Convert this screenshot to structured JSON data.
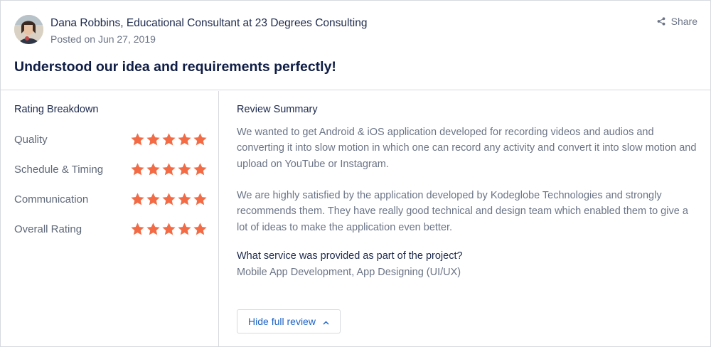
{
  "review": {
    "author": "Dana Robbins, Educational Consultant at 23 Degrees Consulting",
    "posted": "Posted on Jun 27, 2019",
    "share_label": "Share",
    "title": "Understood our idea and requirements perfectly!"
  },
  "ratings": {
    "heading": "Rating Breakdown",
    "items": [
      {
        "label": "Quality",
        "stars": 5
      },
      {
        "label": "Schedule & Timing",
        "stars": 5
      },
      {
        "label": "Communication",
        "stars": 5
      },
      {
        "label": "Overall Rating",
        "stars": 5
      }
    ],
    "star_color": "#f26b45"
  },
  "summary": {
    "heading": "Review Summary",
    "paragraphs": [
      "We wanted to get Android & iOS application developed for recording videos and audios and converting it into slow motion in which one can record any activity and convert it into slow motion and upload on YouTube or Instagram.",
      "We are highly satisfied by the application developed by Kodeglobe Technologies and strongly recommends them. They have really good technical and design team which enabled them to give a lot of ideas to make the application even better."
    ],
    "question": "What service was provided as part of the project?",
    "answer": "Mobile App Development, App Designing (UI/UX)",
    "hide_label": "Hide full review"
  },
  "icons": {
    "share": "share-icon",
    "star": "star-icon",
    "chevron": "chevron-up-icon"
  }
}
